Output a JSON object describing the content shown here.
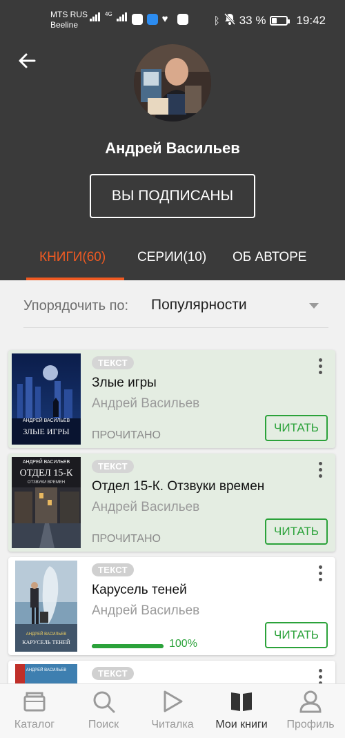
{
  "status_bar": {
    "carrier_1": "MTS RUS",
    "carrier_2": "Beeline",
    "network": "4G",
    "battery": "33 %",
    "battery_level": 0.33,
    "time": "19:42"
  },
  "header": {
    "author_name": "Андрей Васильев",
    "subscribe_label": "ВЫ ПОДПИСАНЫ",
    "tabs": [
      {
        "label": "КНИГИ(60)",
        "active": true
      },
      {
        "label": "СЕРИИ(10)",
        "active": false
      },
      {
        "label": "ОБ АВТОРЕ",
        "active": false
      }
    ]
  },
  "sort": {
    "label": "Упорядочить по:",
    "value": "Популярности"
  },
  "books": [
    {
      "badge": "ТЕКСТ",
      "title": "Злые игры",
      "author": "Андрей Васильев",
      "status": "ПРОЧИТАНО",
      "action": "ЧИТАТЬ",
      "cover_author": "АНДРЕЙ ВАСИЛЬЕВ",
      "cover_title": "ЗЛЫЕ ИГРЫ"
    },
    {
      "badge": "ТЕКСТ",
      "title": "Отдел 15-К. Отзвуки времен",
      "author": "Андрей Васильев",
      "status": "ПРОЧИТАНО",
      "action": "ЧИТАТЬ",
      "cover_author": "АНДРЕЙ ВАСИЛЬЕВ",
      "cover_title": "ОТДЕЛ 15-К",
      "cover_subtitle": "ОТЗВУКИ ВРЕМЕН"
    },
    {
      "badge": "ТЕКСТ",
      "title": "Карусель теней",
      "author": "Андрей Васильев",
      "progress": 1.0,
      "progress_label": "100%",
      "action": "ЧИТАТЬ",
      "cover_author": "АНДРЕЙ ВАСИЛЬЕВ",
      "cover_title": "КАРУСЕЛЬ ТЕНЕЙ"
    },
    {
      "badge": "ТЕКСТ",
      "cover_author": "АНДРЕЙ ВАСИЛЬЕВ"
    }
  ],
  "bottom_nav": [
    {
      "label": "Каталог",
      "icon": "catalog-icon",
      "active": false
    },
    {
      "label": "Поиск",
      "icon": "search-icon",
      "active": false
    },
    {
      "label": "Читалка",
      "icon": "play-icon",
      "active": false
    },
    {
      "label": "Мои книги",
      "icon": "book-icon",
      "active": true
    },
    {
      "label": "Профиль",
      "icon": "profile-icon",
      "active": false
    }
  ],
  "colors": {
    "header_bg": "#3a3a3a",
    "accent": "#f05a22",
    "read_card_bg": "#e4ede2",
    "green": "#2ba23a"
  }
}
